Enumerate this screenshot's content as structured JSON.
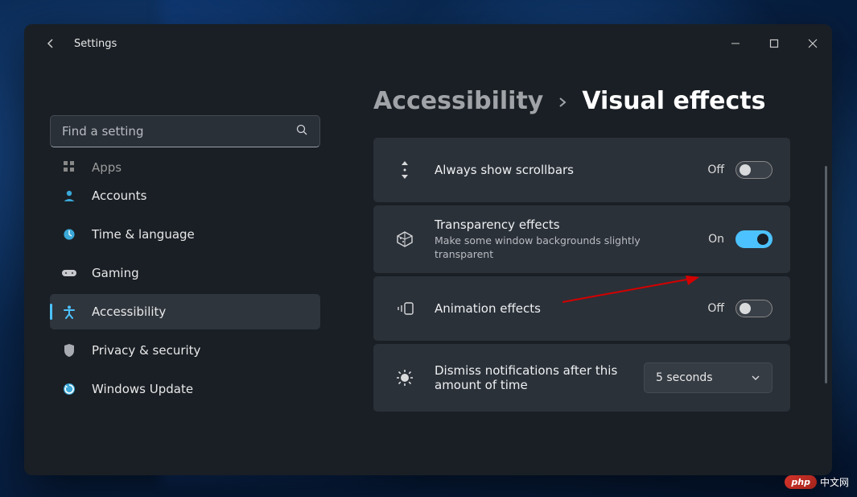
{
  "app_title": "Settings",
  "search": {
    "placeholder": "Find a setting"
  },
  "sidebar": {
    "items": [
      {
        "label": "Apps"
      },
      {
        "label": "Accounts"
      },
      {
        "label": "Time & language"
      },
      {
        "label": "Gaming"
      },
      {
        "label": "Accessibility"
      },
      {
        "label": "Privacy & security"
      },
      {
        "label": "Windows Update"
      }
    ]
  },
  "breadcrumb": {
    "parent": "Accessibility",
    "current": "Visual effects"
  },
  "settings": [
    {
      "title": "Always show scrollbars",
      "toggle_state": "Off",
      "toggle_on": false
    },
    {
      "title": "Transparency effects",
      "sub": "Make some window backgrounds slightly transparent",
      "toggle_state": "On",
      "toggle_on": true
    },
    {
      "title": "Animation effects",
      "toggle_state": "Off",
      "toggle_on": false
    },
    {
      "title": "Dismiss notifications after this amount of time",
      "dropdown_value": "5 seconds"
    }
  ],
  "watermark": {
    "badge": "php",
    "text": "中文网"
  }
}
